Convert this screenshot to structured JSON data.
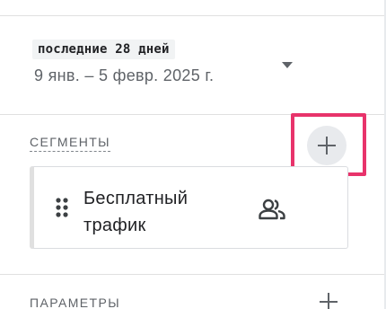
{
  "date": {
    "preset": "последние 28 дней",
    "range": "9 янв. – 5 февр. 2025 г.",
    "dropdown_icon": "arrow-drop-down-icon"
  },
  "segments": {
    "title": "СЕГМЕНТЫ",
    "add_icon": "plus-icon",
    "highlight_color": "#e8336b",
    "items": [
      {
        "label": "Бесплатный трафик",
        "icon": "user-group-icon"
      }
    ]
  },
  "parameters": {
    "title": "ПАРАМЕТРЫ",
    "add_icon": "plus-icon"
  }
}
